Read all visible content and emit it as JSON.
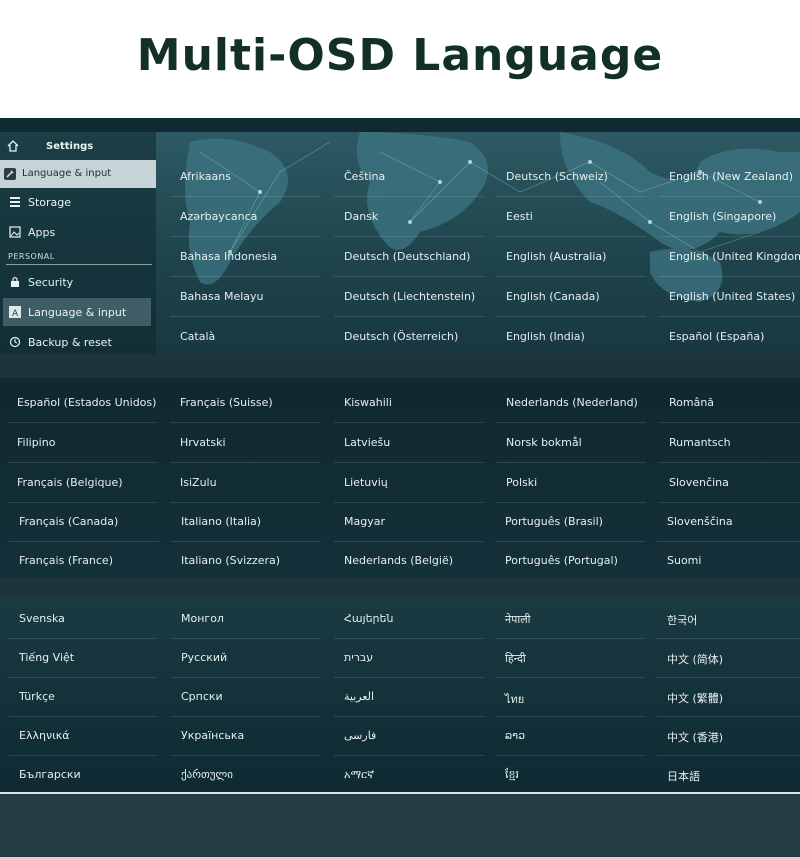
{
  "banner": {
    "title": "Multi-OSD Language"
  },
  "sidebar": {
    "header": "Settings",
    "top_item": "Language & input",
    "items": [
      "Storage",
      "Apps"
    ],
    "section": "PERSONAL",
    "personal_items": [
      "Security",
      "Language & input",
      "Backup & reset"
    ]
  },
  "panel1": {
    "columns": [
      [
        "Afrikaans",
        "Azərbaycanca",
        "Bahasa Indonesia",
        "Bahasa Melayu",
        "Català"
      ],
      [
        "Čeština",
        "Dansk",
        "Deutsch (Deutschland)",
        "Deutsch (Liechtenstein)",
        "Deutsch (Österreich)"
      ],
      [
        "Deutsch (Schweiz)",
        "Eesti",
        "English (Australia)",
        "English (Canada)",
        "English (India)"
      ],
      [
        "English (New Zealand)",
        "English (Singapore)",
        "English (United Kingdom)",
        "English (United States)",
        "Español (España)"
      ]
    ]
  },
  "panel2": {
    "columns": [
      [
        "Español (Estados Unidos)",
        "Filipino",
        "Français (Belgique)",
        "Français (Canada)",
        "Français (France)"
      ],
      [
        "Français (Suisse)",
        "Hrvatski",
        "IsiZulu",
        "Italiano (Italia)",
        "Italiano (Svizzera)"
      ],
      [
        "Kiswahili",
        "Latviešu",
        "Lietuvių",
        "Magyar",
        "Nederlands (België)"
      ],
      [
        "Nederlands (Nederland)",
        "Norsk bokmål",
        "Polski",
        "Português (Brasil)",
        "Português (Portugal)"
      ],
      [
        "Română",
        "Rumantsch",
        "Slovenčina",
        "Slovenščina",
        "Suomi"
      ]
    ]
  },
  "panel3": {
    "columns": [
      [
        "Svenska",
        "Tiếng Việt",
        "Türkçe",
        "Ελληνικά",
        "Български"
      ],
      [
        "Монгол",
        "Русский",
        "Српски",
        "Українська",
        "ქართული"
      ],
      [
        "Հայերեն",
        "עברית",
        "العربية",
        "فارسی",
        "አማርኛ"
      ],
      [
        "नेपाली",
        "हिन्दी",
        "ไทย",
        "ລາວ",
        "ខ្មែរ"
      ],
      [
        "한국어",
        "中文 (简体)",
        "中文 (繁體)",
        "中文 (香港)",
        "日本語"
      ]
    ]
  },
  "colors": {
    "banner_title": "#123028",
    "panel_bg": "#1f444d",
    "sidebar_active": "#c7d4d7"
  }
}
